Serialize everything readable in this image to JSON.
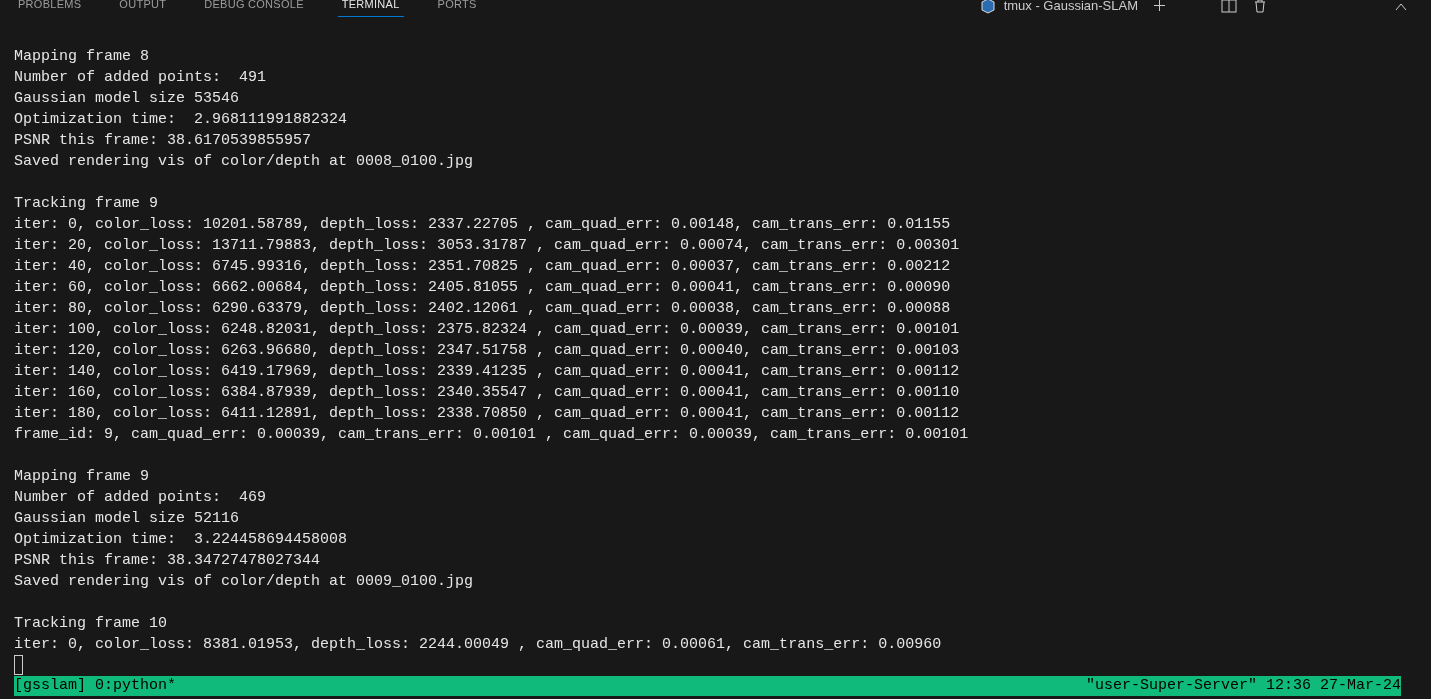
{
  "panel_tabs": [
    {
      "label": "PROBLEMS",
      "selected": false
    },
    {
      "label": "OUTPUT",
      "selected": false
    },
    {
      "label": "DEBUG CONSOLE",
      "selected": false
    },
    {
      "label": "TERMINAL",
      "selected": true
    },
    {
      "label": "PORTS",
      "selected": false
    }
  ],
  "terminal_title": "tmux - Gaussian-SLAM",
  "terminal_blocks": [
    [
      "Mapping frame 8",
      "Number of added points:  491",
      "Gaussian model size 53546",
      "Optimization time:  2.968111991882324",
      "PSNR this frame: 38.6170539855957",
      "Saved rendering vis of color/depth at 0008_0100.jpg"
    ],
    [
      "Tracking frame 9",
      "iter: 0, color_loss: 10201.58789, depth_loss: 2337.22705 , cam_quad_err: 0.00148, cam_trans_err: 0.01155",
      "iter: 20, color_loss: 13711.79883, depth_loss: 3053.31787 , cam_quad_err: 0.00074, cam_trans_err: 0.00301",
      "iter: 40, color_loss: 6745.99316, depth_loss: 2351.70825 , cam_quad_err: 0.00037, cam_trans_err: 0.00212",
      "iter: 60, color_loss: 6662.00684, depth_loss: 2405.81055 , cam_quad_err: 0.00041, cam_trans_err: 0.00090",
      "iter: 80, color_loss: 6290.63379, depth_loss: 2402.12061 , cam_quad_err: 0.00038, cam_trans_err: 0.00088",
      "iter: 100, color_loss: 6248.82031, depth_loss: 2375.82324 , cam_quad_err: 0.00039, cam_trans_err: 0.00101",
      "iter: 120, color_loss: 6263.96680, depth_loss: 2347.51758 , cam_quad_err: 0.00040, cam_trans_err: 0.00103",
      "iter: 140, color_loss: 6419.17969, depth_loss: 2339.41235 , cam_quad_err: 0.00041, cam_trans_err: 0.00112",
      "iter: 160, color_loss: 6384.87939, depth_loss: 2340.35547 , cam_quad_err: 0.00041, cam_trans_err: 0.00110",
      "iter: 180, color_loss: 6411.12891, depth_loss: 2338.70850 , cam_quad_err: 0.00041, cam_trans_err: 0.00112",
      "frame_id: 9, cam_quad_err: 0.00039, cam_trans_err: 0.00101 , cam_quad_err: 0.00039, cam_trans_err: 0.00101"
    ],
    [
      "Mapping frame 9",
      "Number of added points:  469",
      "Gaussian model size 52116",
      "Optimization time:  3.224458694458008",
      "PSNR this frame: 38.34727478027344",
      "Saved rendering vis of color/depth at 0009_0100.jpg"
    ],
    [
      "Tracking frame 10",
      "iter: 0, color_loss: 8381.01953, depth_loss: 2244.00049 , cam_quad_err: 0.00061, cam_trans_err: 0.00960"
    ]
  ],
  "status_bar": {
    "left": "[gsslam] 0:python*",
    "right": "\"user-Super-Server\" 12:36 27-Mar-24"
  }
}
